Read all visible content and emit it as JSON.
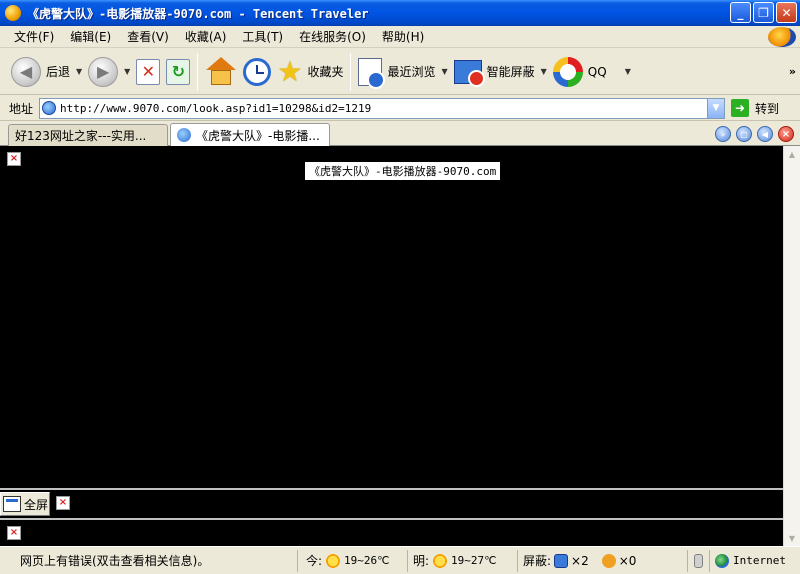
{
  "window": {
    "title": "《虎警大队》-电影播放器-9070.com - Tencent Traveler",
    "buttons": {
      "minimize": "_",
      "restore": "❐",
      "close": "✕"
    }
  },
  "menu": [
    "文件(F)",
    "编辑(E)",
    "查看(V)",
    "收藏(A)",
    "工具(T)",
    "在线服务(O)",
    "帮助(H)"
  ],
  "toolbar": {
    "back_label": "后退",
    "favorites_label": "收藏夹",
    "recent_label": "最近浏览",
    "block_label": "智能屏蔽",
    "qq_label": "QQ",
    "overflow": "»"
  },
  "address": {
    "label": "地址",
    "url": "http://www.9070.com/look.asp?id1=10298&id2=1219",
    "go_label": "转到"
  },
  "tabs": [
    {
      "label": "好123网址之家---实用..."
    },
    {
      "label": "《虎警大队》-电影播..."
    }
  ],
  "content": {
    "page_title": "《虎警大队》-电影播放器-9070.com",
    "fullscreen_label": "全屏",
    "broken_image_glyph": "×"
  },
  "status": {
    "message": "网页上有错误(双击查看相关信息)。",
    "today_label": "今:",
    "today_temp": "19~26℃",
    "tomorrow_label": "明:",
    "tomorrow_temp": "19~27℃",
    "block_label": "屏蔽:",
    "block_count_1": "×2",
    "block_count_2": "×0",
    "zone": "Internet"
  },
  "colors": {
    "titlebar": "#0054e3",
    "content_bg": "#000000",
    "chrome_bg": "#ece9d8"
  }
}
